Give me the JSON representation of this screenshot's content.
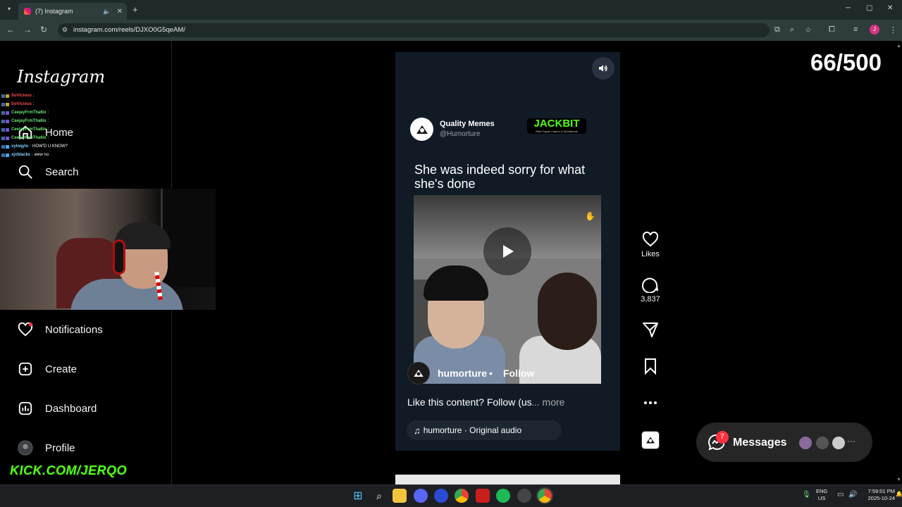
{
  "browser": {
    "tab_title": "(7) Instagram",
    "url": "instagram.com/reels/DJXO0G5qeAM/",
    "profile_initial": "J",
    "new_tab": "+",
    "tab_close": "✕",
    "win_min": "─",
    "win_max": "▢",
    "win_close": "✕"
  },
  "sidebar": {
    "logo": "Instagram",
    "items": [
      {
        "label": "Home",
        "icon": "home-icon"
      },
      {
        "label": "Search",
        "icon": "search-icon"
      },
      {
        "label": "Notifications",
        "icon": "heart-icon"
      },
      {
        "label": "Create",
        "icon": "plus-square-icon"
      },
      {
        "label": "Dashboard",
        "icon": "dashboard-icon"
      },
      {
        "label": "Profile",
        "icon": "avatar-icon"
      }
    ]
  },
  "chat": [
    {
      "user": "SoVicious",
      "msg": "",
      "color": "#ff4d4d"
    },
    {
      "user": "SoVicious",
      "msg": "",
      "color": "#ff4d4d"
    },
    {
      "user": "CeejayFrmTha6ix",
      "msg": "",
      "color": "#6be675"
    },
    {
      "user": "CeejayFrmTha6ix",
      "msg": "",
      "color": "#6be675"
    },
    {
      "user": "CeejayFrmTha6ix",
      "msg": "",
      "color": "#6be675"
    },
    {
      "user": "CeejayFrmTha6ix",
      "msg": "",
      "color": "#6be675"
    },
    {
      "user": "xyloqylo",
      "msg": "HOW'D U KNOW?",
      "color": "#7fd6ff"
    },
    {
      "user": "xjxblackx",
      "msg": "eww no",
      "color": "#7fd6ff"
    }
  ],
  "overlay": {
    "kick": "KICK.COM/JERQO",
    "counter": "66/500"
  },
  "reel": {
    "post_name": "Quality Memes",
    "post_handle": "@Humorture",
    "sponsor": "JACKBIT",
    "sponsor_sub": "Best Crypto Casino & Sportsbook",
    "caption": "She was indeed sorry for what she's done",
    "author": "humorture",
    "author_dot": "•",
    "follow": "Follow",
    "description": "Like this content? Follow (us",
    "more": "... more",
    "audio": "humorture · Original audio",
    "audio_note": "♫"
  },
  "actions": {
    "likes_label": "Likes",
    "comments_count": "3,837"
  },
  "messages": {
    "label": "Messages",
    "badge": "7",
    "more": "···"
  },
  "taskbar": {
    "lang_line1": "ENG",
    "lang_line2": "US",
    "time": "7:59:01 PM",
    "date": "2025-10-24"
  },
  "colors": {
    "instagram_badge": "#ff3040",
    "kick_green": "#53fc18",
    "reel_bg": "#101b26"
  }
}
